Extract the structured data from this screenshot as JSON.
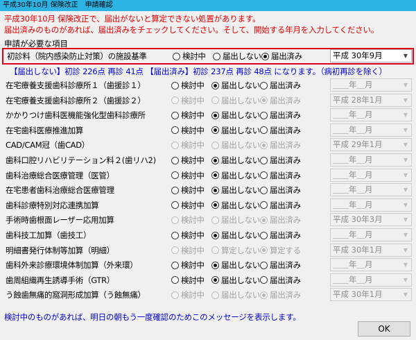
{
  "window": {
    "title": "平成30年10月 保険改正　申請確認"
  },
  "notice": [
    "平成30年10月 保険改正で、届出がないと算定できない処置があります。",
    "届出済みのものがあれば、届出済みをチェックしてください。そして、開始する年月を入力してください。"
  ],
  "section_label": "申請が必要な項目",
  "radio_labels": {
    "considering": "検討中",
    "not_filed": "届出しない",
    "filed": "届出済み",
    "not_calculated": "算定しない",
    "calculate": "算定する"
  },
  "main_item": {
    "label": "初診料（院内感染防止対策）の施設基準",
    "selected": "filed",
    "date": "平成 30年9月"
  },
  "summary": "【届出しない】初診 226点 再診 41点 【届出済み】初診 237点 再診 48点 になります。（病初再診を除く）",
  "items": [
    {
      "label": "在宅療養支援歯科診療所１（歯援診１）",
      "selected": "not_filed",
      "enabled": true,
      "date": "＿＿年＿月",
      "combo_enabled": false
    },
    {
      "label": "在宅療養支援歯科診療所２（歯援診２）",
      "selected": "filed",
      "enabled": false,
      "date": "平成 28年1月",
      "combo_enabled": false
    },
    {
      "label": "かかりつけ歯科医機能強化型歯科診療所",
      "selected": "not_filed",
      "enabled": true,
      "date": "＿＿年＿月",
      "combo_enabled": false
    },
    {
      "label": "在宅歯科医療推進加算",
      "selected": "not_filed",
      "enabled": true,
      "date": "＿＿年＿月",
      "combo_enabled": false
    },
    {
      "label": "CAD/CAM冠（歯CAD）",
      "selected": "filed",
      "enabled": false,
      "date": "平成 29年1月",
      "combo_enabled": false
    },
    {
      "label": "歯科口腔リハビリテーション料２(歯リハ2)",
      "selected": "not_filed",
      "enabled": true,
      "date": "＿＿年＿月",
      "combo_enabled": false
    },
    {
      "label": "歯科治療総合医療管理（医管）",
      "selected": "not_filed",
      "enabled": true,
      "date": "＿＿年＿月",
      "combo_enabled": false
    },
    {
      "label": "在宅患者歯科治療総合医療管理",
      "selected": "not_filed",
      "enabled": true,
      "date": "＿＿年＿月",
      "combo_enabled": false
    },
    {
      "label": "歯科診療特別対応連携加算",
      "selected": "not_filed",
      "enabled": true,
      "date": "＿＿年＿月",
      "combo_enabled": false
    },
    {
      "label": "手術時歯根面レーザー応用加算",
      "selected": "filed",
      "enabled": false,
      "date": "平成 30年3月",
      "combo_enabled": false
    },
    {
      "label": "歯科技工加算（歯技工）",
      "selected": "not_filed",
      "enabled": true,
      "date": "＿＿年＿月",
      "combo_enabled": false
    },
    {
      "label": "明細書発行体制等加算（明細）",
      "selected": "calculate",
      "enabled": false,
      "alt": true,
      "date": "平成 30年1月",
      "combo_enabled": false
    },
    {
      "label": "歯科外来診療環境体制加算（外来環）",
      "selected": "not_filed",
      "enabled": true,
      "date": "＿＿年＿月",
      "combo_enabled": false
    },
    {
      "label": "歯周組織再生誘導手術（GTR）",
      "selected": "not_filed",
      "enabled": true,
      "date": "＿＿年＿月",
      "combo_enabled": false
    },
    {
      "label": "う蝕歯無痛的窩洞形成加算（う蝕無痛）",
      "selected": "filed",
      "enabled": false,
      "date": "平成 30年1月",
      "combo_enabled": false
    }
  ],
  "footer_note": "検討中のものがあれば、明日の朝もう一度確認のためこのメッセージを表示します。",
  "ok_label": "OK",
  "icons": {
    "radio": "radio-button-icon",
    "dropdown": "chevron-down-icon"
  },
  "colors": {
    "titlebar": "#2cb3e3",
    "notice": "#e00000",
    "summary": "#0000d0",
    "highlight_border": "#e0001b"
  }
}
